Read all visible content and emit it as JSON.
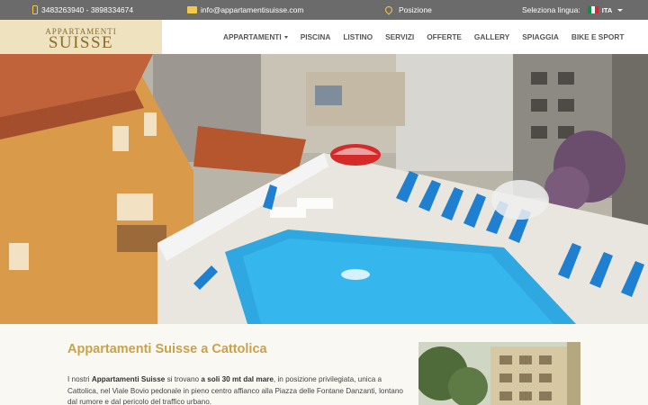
{
  "topbar": {
    "phone": "3483263940 - 3898334674",
    "email": "info@appartamentisuisse.com",
    "position_label": "Posizione",
    "language_label": "Seleziona lingua:",
    "language_code": "ITA",
    "icons": [
      "phone-icon",
      "mail-icon",
      "map-pin-icon",
      "italy-flag-icon",
      "caret-down-icon"
    ],
    "accent_color": "#f2c94c"
  },
  "header": {
    "logo_small": "APPARTAMENTI",
    "logo_big": "SUISSE",
    "logo_bg": "#efe2bf",
    "nav": [
      "APPARTAMENTI",
      "PISCINA",
      "LISTINO",
      "SERVIZI",
      "OFFERTE",
      "GALLERY",
      "SPIAGGIA",
      "BIKE E SPORT"
    ]
  },
  "content": {
    "title": "Appartamenti Suisse a Cattolica",
    "intro_prefix": "I nostri ",
    "intro_bold1": "Appartamenti Suisse",
    "intro_mid": " si trovano ",
    "intro_bold2": "a soli 30 mt dal mare",
    "intro_rest": ", in posizione privilegiata, unica a Cattolica, nel Viale Bovio pedonale in pieno centro affianco alla Piazza delle Fontane Danzanti, lontano dal rumore e dal pericolo del traffico urbano.",
    "title_color": "#c9a24a"
  }
}
